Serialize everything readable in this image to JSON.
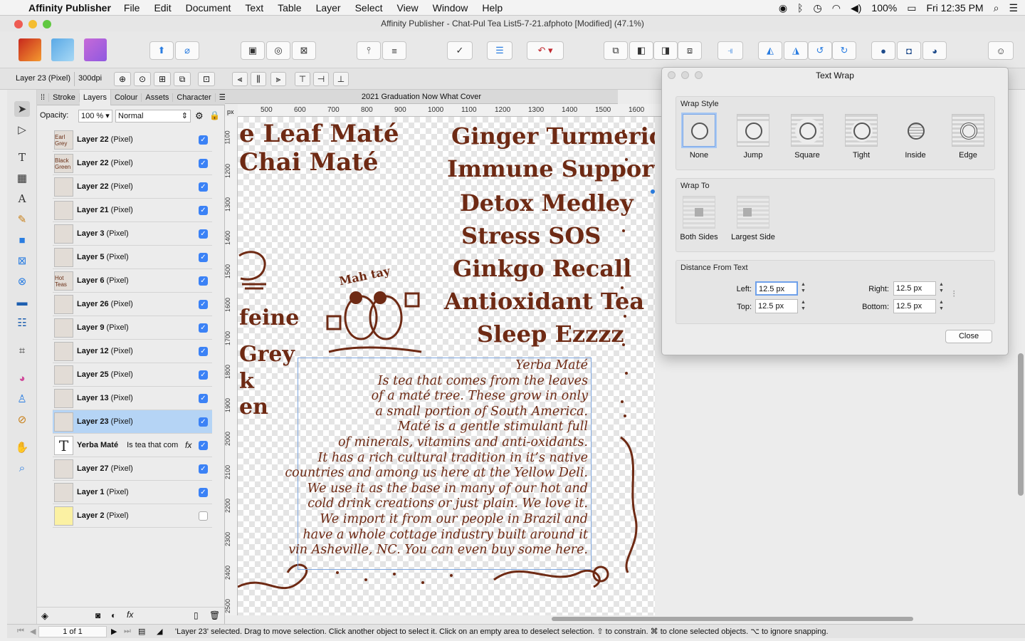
{
  "menubar": {
    "app_name": "Affinity Publisher",
    "items": [
      "File",
      "Edit",
      "Document",
      "Text",
      "Table",
      "Layer",
      "Select",
      "View",
      "Window",
      "Help"
    ],
    "battery": "100%",
    "clock": "Fri 12:35 PM"
  },
  "window": {
    "title": "Affinity Publisher - Chat-Pul Tea List5-7-21.afphoto [Modified] (47.1%)"
  },
  "context_bar": {
    "layer_label": "Layer 23 (Pixel)",
    "dpi": "300dpi"
  },
  "panel": {
    "tabs": [
      "Stroke",
      "Layers",
      "Colour",
      "Assets",
      "Character"
    ],
    "active_tab": "Layers",
    "opacity_label": "Opacity:",
    "opacity_value": "100 %",
    "blend_mode": "Normal",
    "layers": [
      {
        "name": "Layer 22",
        "type": "(Pixel)",
        "thumb": "Earl Grey",
        "visible": true
      },
      {
        "name": "Layer 22",
        "type": "(Pixel)",
        "thumb": "Black Green",
        "visible": true
      },
      {
        "name": "Layer 22",
        "type": "(Pixel)",
        "thumb": "",
        "visible": true
      },
      {
        "name": "Layer 21",
        "type": "(Pixel)",
        "thumb": "",
        "visible": true
      },
      {
        "name": "Layer 3",
        "type": "(Pixel)",
        "thumb": "",
        "visible": true
      },
      {
        "name": "Layer 5",
        "type": "(Pixel)",
        "thumb": "",
        "visible": true
      },
      {
        "name": "Layer 6",
        "type": "(Pixel)",
        "thumb": "Hot Teas",
        "visible": true
      },
      {
        "name": "Layer 26",
        "type": "(Pixel)",
        "thumb": "",
        "visible": true
      },
      {
        "name": "Layer 9",
        "type": "(Pixel)",
        "thumb": "",
        "visible": true
      },
      {
        "name": "Layer 12",
        "type": "(Pixel)",
        "thumb": "",
        "visible": true
      },
      {
        "name": "Layer 25",
        "type": "(Pixel)",
        "thumb": "",
        "visible": true
      },
      {
        "name": "Layer 13",
        "type": "(Pixel)",
        "thumb": "",
        "visible": true
      },
      {
        "name": "Layer 23",
        "type": "(Pixel)",
        "thumb": "",
        "visible": true,
        "selected": true
      },
      {
        "name": "Yerba Maté",
        "type": "Is tea that com",
        "thumb": "T",
        "visible": true,
        "text": true
      },
      {
        "name": "Layer 27",
        "type": "(Pixel)",
        "thumb": "",
        "visible": true
      },
      {
        "name": "Layer 1",
        "type": "(Pixel)",
        "thumb": "",
        "visible": true
      },
      {
        "name": "Layer 2",
        "type": "(Pixel)",
        "thumb": "",
        "visible": false,
        "yellow": true
      }
    ]
  },
  "document": {
    "tab_title": "2021 Graduation Now What Cover",
    "ruler_unit": "px",
    "ruler_top": [
      "500",
      "600",
      "700",
      "800",
      "900",
      "1000",
      "1100",
      "1200",
      "1300",
      "1400",
      "1500",
      "1600"
    ],
    "ruler_left": [
      "1100",
      "1200",
      "1300",
      "1400",
      "1500",
      "1600",
      "1700",
      "1800",
      "1900",
      "2000",
      "2100",
      "2200",
      "2300",
      "2400",
      "2500"
    ],
    "left_words": [
      "e Leaf Maté",
      "Chai Maté",
      "feine",
      "Grey",
      "k",
      "en"
    ],
    "tea_names": [
      "Ginger Turmeric",
      "Immune Support",
      "Detox Medley",
      "Stress SOS",
      "Ginkgo Recall",
      "Antioxidant Tea",
      "Sleep Ezzzz"
    ],
    "logo_text": "Mah tay",
    "body_lines": [
      "Yerba Maté",
      "Is tea that comes from the leaves",
      "of a maté tree. These grow in only",
      "a small portion of South America.",
      "Maté is a gentle stimulant full",
      "of minerals, vitamins and anti-oxidants.",
      "It has a rich cultural tradition in it’s native",
      "countries and among us here at the Yellow Deli.",
      "We use it as the base in many of our hot and",
      "cold drink creations or just plain. We love it.",
      "We import it from our people in Brazil and",
      "have a whole cottage industry built around it",
      "vin Asheville, NC.  You can even buy some here."
    ]
  },
  "dialog": {
    "title": "Text Wrap",
    "wrap_style_label": "Wrap Style",
    "wrap_styles": [
      "None",
      "Jump",
      "Square",
      "Tight",
      "Inside",
      "Edge"
    ],
    "selected_style": "None",
    "wrap_to_label": "Wrap To",
    "wrap_to": [
      "Both Sides",
      "Largest Side"
    ],
    "distance_label": "Distance From Text",
    "left_label": "Left:",
    "left_value": "12.5 px",
    "top_label": "Top:",
    "top_value": "12.5 px",
    "right_label": "Right:",
    "right_value": "12.5 px",
    "bottom_label": "Bottom:",
    "bottom_value": "12.5 px",
    "close_label": "Close"
  },
  "status": {
    "page_indicator": "1 of 1",
    "message": "'Layer 23' selected. Drag to move selection. Click another object to select it. Click on an empty area to deselect selection. ⇧ to constrain. ⌘ to clone selected objects. ⌥ to ignore snapping."
  },
  "colors": {
    "ink": "#6e2a14",
    "selection": "#b5d4f5",
    "accent": "#3b82f6"
  }
}
